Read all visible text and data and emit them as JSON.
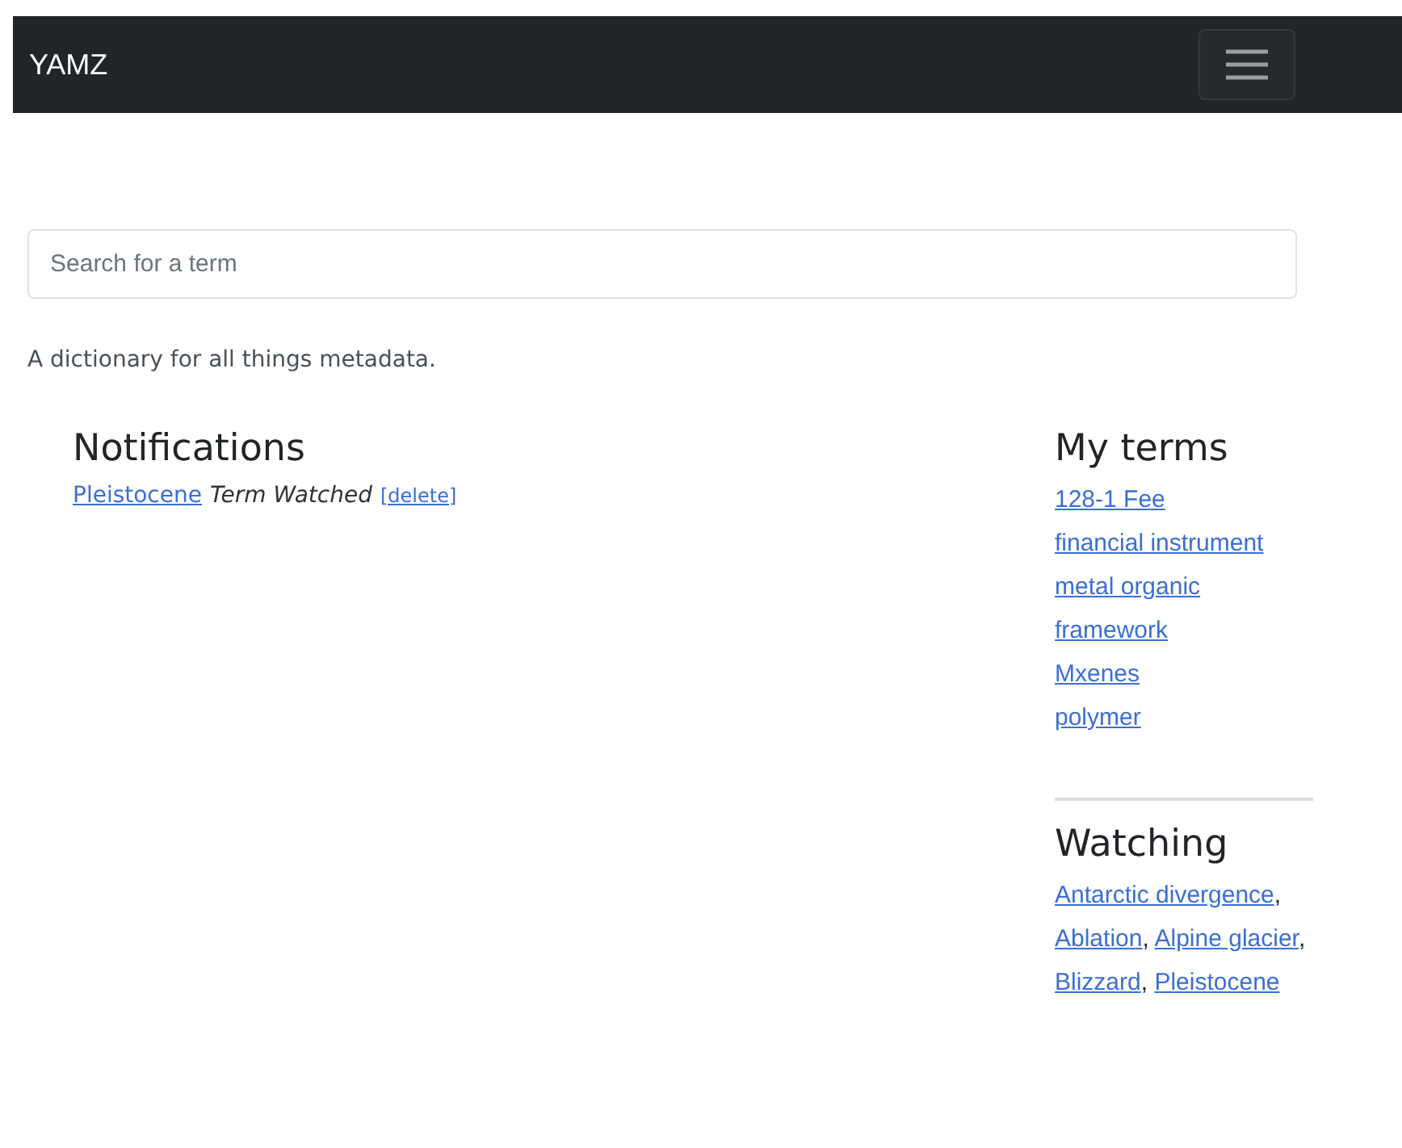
{
  "navbar": {
    "brand": "YAMZ"
  },
  "search": {
    "placeholder": "Search for a term"
  },
  "tagline": "A dictionary for all things metadata.",
  "notifications": {
    "title": "Notifications",
    "items": [
      {
        "term": "Pleistocene",
        "message": "Term Watched",
        "action": "[delete]"
      }
    ]
  },
  "my_terms": {
    "title": "My terms",
    "items": [
      "128-1 Fee",
      "financial instrument",
      "metal organic framework",
      "Mxenes",
      "polymer"
    ]
  },
  "watching": {
    "title": "Watching",
    "items": [
      {
        "term": "Antarctic divergence",
        "separator": ","
      },
      {
        "term": "Ablation",
        "separator": ","
      },
      {
        "term": "Alpine glacier",
        "separator": ","
      },
      {
        "term": "Blizzard",
        "separator": ","
      },
      {
        "term": "Pleistocene"
      }
    ]
  }
}
